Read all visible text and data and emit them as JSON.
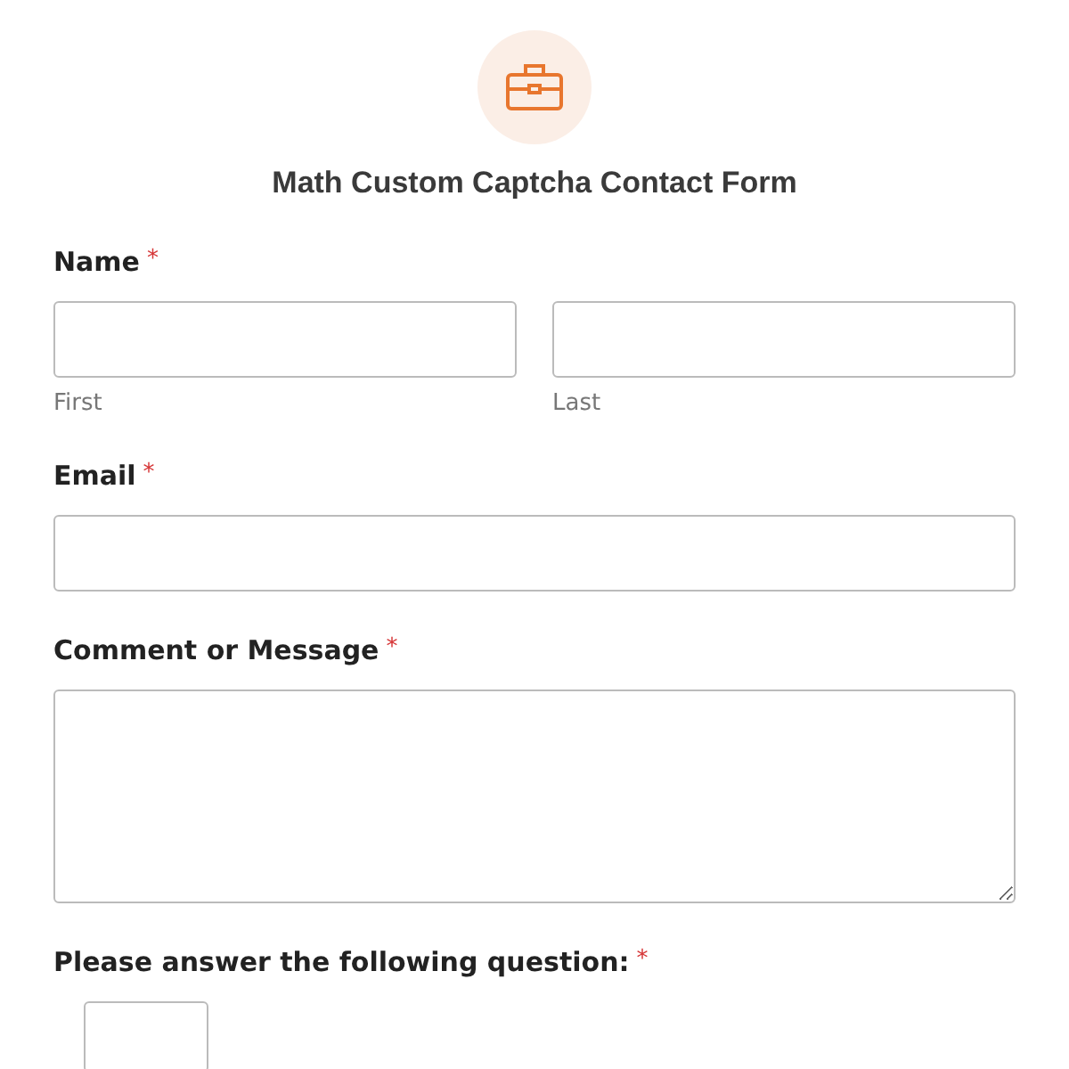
{
  "form": {
    "title": "Math Custom Captcha Contact Form"
  },
  "fields": [
    {
      "kind": "name",
      "label": "Name",
      "required_mark": "*",
      "sublabels": [
        "First",
        "Last"
      ]
    },
    {
      "kind": "email",
      "label": "Email",
      "required_mark": "*"
    },
    {
      "kind": "textarea",
      "label": "Comment or Message",
      "required_mark": "*"
    },
    {
      "kind": "captcha",
      "label": "Please answer the following question:",
      "required_mark": "*"
    }
  ]
}
